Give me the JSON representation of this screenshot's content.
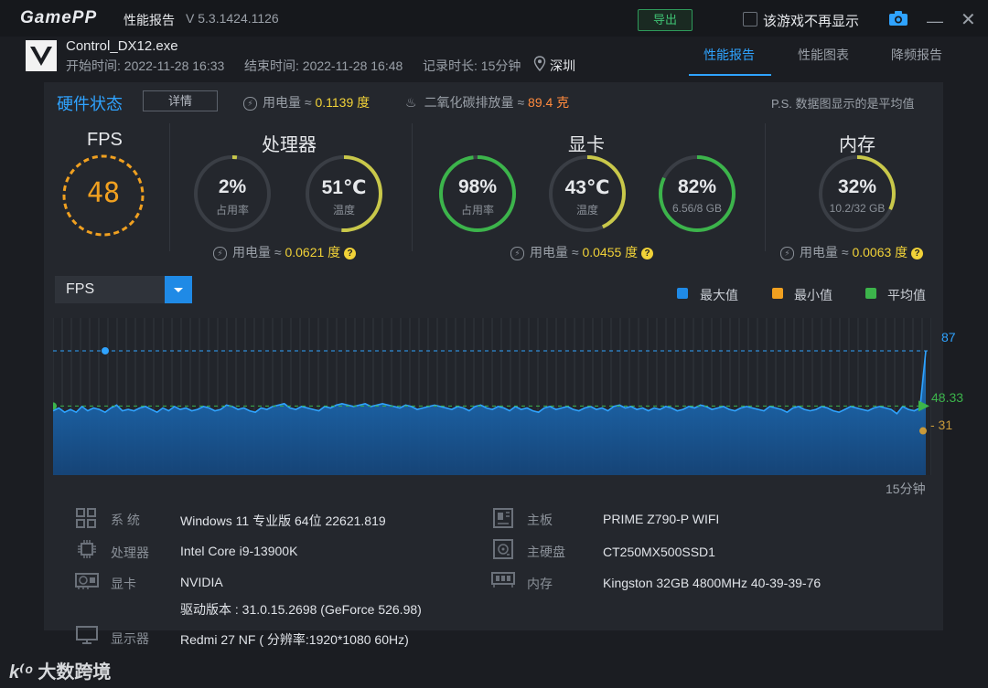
{
  "titlebar": {
    "logo": "GamePP",
    "app_name": "性能报告",
    "version": "V 5.3.1424.1126",
    "export_label": "导出",
    "dont_show_label": "该游戏不再显示"
  },
  "header": {
    "game_name": "Control_DX12.exe",
    "start_time": "开始时间: 2022-11-28 16:33",
    "end_time": "结束时间: 2022-11-28 16:48",
    "duration": "记录时长: 15分钟",
    "city": "深圳",
    "tabs": [
      {
        "label": "性能报告",
        "active": true
      },
      {
        "label": "性能图表",
        "active": false
      },
      {
        "label": "降频报告",
        "active": false
      }
    ]
  },
  "hardware_status": {
    "title": "硬件状态",
    "detail_button": "详情",
    "power_label": "用电量 ≈",
    "power_value": "0.1139 度",
    "co2_label": "二氧化碳排放量 ≈",
    "co2_value": "89.4 克",
    "note": "P.S. 数据图显示的是平均值"
  },
  "sections": {
    "fps": {
      "title": "FPS",
      "value": "48"
    },
    "cpu": {
      "title": "处理器",
      "usage": {
        "value": "2%",
        "label": "占用率",
        "level": 0.02
      },
      "temp": {
        "value": "51℃",
        "label": "温度",
        "level": 0.51
      },
      "power_label": "用电量 ≈",
      "power_value": "0.0621 度"
    },
    "gpu": {
      "title": "显卡",
      "usage": {
        "value": "98%",
        "label": "占用率",
        "level": 0.98
      },
      "temp": {
        "value": "43℃",
        "label": "温度",
        "level": 0.43
      },
      "mem": {
        "value": "82%",
        "label": "6.56/8 GB",
        "level": 0.82
      },
      "power_label": "用电量 ≈",
      "power_value": "0.0455 度"
    },
    "memory": {
      "title": "内存",
      "usage": {
        "value": "32%",
        "label": "10.2/32 GB",
        "level": 0.32
      },
      "power_label": "用电量 ≈",
      "power_value": "0.0063 度"
    }
  },
  "chart_controls": {
    "metric_selected": "FPS",
    "legend": [
      {
        "label": "最大值",
        "color": "#1f8ae6"
      },
      {
        "label": "最小值",
        "color": "#f0a020"
      },
      {
        "label": "平均值",
        "color": "#3cb44b"
      }
    ]
  },
  "chart_data": {
    "type": "area",
    "series": [
      {
        "values": [
          45,
          47,
          44,
          46,
          44,
          48,
          45,
          47,
          46,
          44,
          47,
          49,
          45,
          46,
          45,
          47,
          48,
          46,
          44,
          47,
          45,
          48,
          46,
          47,
          45,
          46,
          48,
          47,
          45,
          46,
          49,
          48,
          46,
          47,
          45,
          44,
          47,
          46,
          48,
          49,
          50,
          47,
          46,
          48,
          47,
          46,
          45,
          48,
          47,
          49,
          50,
          49,
          48,
          49,
          50,
          48,
          49,
          50,
          49,
          48,
          47,
          49,
          48,
          46,
          47,
          48,
          49,
          48,
          47,
          46,
          48,
          47,
          45,
          48,
          49,
          47,
          46,
          48,
          47,
          45,
          48,
          46,
          47,
          45,
          44,
          47,
          48,
          46,
          47,
          48,
          46,
          45,
          47,
          48,
          46,
          47,
          45,
          48,
          49,
          47,
          48,
          46,
          47,
          45,
          47,
          46,
          48,
          47,
          45,
          46,
          48,
          47,
          49,
          48,
          46,
          47,
          48,
          46,
          45,
          47,
          48,
          47,
          46,
          45,
          48,
          47,
          46,
          44,
          47,
          48,
          46,
          45,
          46,
          48,
          47,
          45,
          44,
          46,
          48,
          47,
          46,
          45,
          47,
          48,
          47,
          46,
          43,
          48,
          46,
          45,
          47,
          87
        ]
      }
    ],
    "max": 87,
    "min": 31,
    "avg": 48.33,
    "duration_label": "15分钟",
    "labels": {
      "max": "87",
      "min": "- 31",
      "avg": "48.33"
    }
  },
  "system_info": {
    "left": [
      {
        "label": "系 统",
        "value": "Windows 11 专业版 64位 22621.819",
        "icon": "system-icon"
      },
      {
        "label": "处理器",
        "value": "Intel Core i9-13900K",
        "icon": "cpu-icon"
      },
      {
        "label": "显卡",
        "value": "NVIDIA",
        "icon": "gpu-icon"
      },
      {
        "label": "",
        "value": "驱动版本 : 31.0.15.2698 (GeForce 526.98)",
        "icon": ""
      },
      {
        "label": "显示器",
        "value": "Redmi 27 NF ( 分辨率:1920*1080 60Hz)",
        "icon": "monitor-icon"
      }
    ],
    "right": [
      {
        "label": "主板",
        "value": "PRIME Z790-P WIFI",
        "icon": "motherboard-icon"
      },
      {
        "label": "主硬盘",
        "value": "CT250MX500SSD1",
        "icon": "disk-icon"
      },
      {
        "label": "内存",
        "value": "Kingston 32GB 4800MHz 40-39-39-76",
        "icon": "ram-icon"
      }
    ]
  },
  "watermark": "大数跨境",
  "colors": {
    "accent": "#2fa3ff",
    "green": "#3cb44b",
    "yellow": "#f1d238",
    "orange": "#f0a020"
  }
}
